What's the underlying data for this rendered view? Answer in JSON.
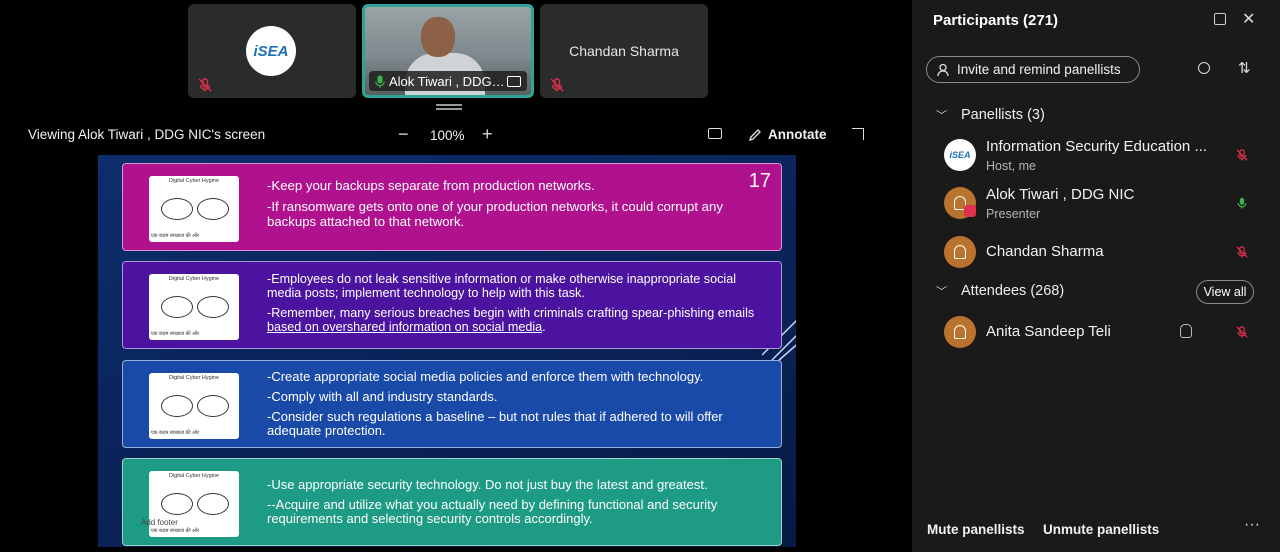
{
  "video_strip": {
    "tiles": [
      {
        "logo_text": "iSEA"
      },
      {
        "name": "Alok Tiwari , DDG NIC"
      },
      {
        "name": "Chandan Sharma"
      }
    ]
  },
  "share_bar": {
    "viewing_text": "Viewing Alok Tiwari , DDG NIC's screen",
    "zoom_level": "100%",
    "zoom_out": "−",
    "zoom_in": "+",
    "annotate_label": "Annotate"
  },
  "slide": {
    "number": "17",
    "thumb_title": "Digital Cyber Hygine",
    "thumb_word_left": "स्वच्छ",
    "thumb_word_right": "भारत",
    "thumb_sub": "एक कदम स्वच्छता की ओर",
    "cards": [
      {
        "lines": [
          "-Keep your backups separate from production networks.",
          "-If ransomware gets onto one of your production networks, it could corrupt any backups attached to that network."
        ]
      },
      {
        "lines": [
          "-Employees do not leak sensitive information or make otherwise inappropriate social media posts; implement technology to help with this task.",
          "-Remember, many serious breaches begin with criminals crafting spear-phishing emails ",
          "based on overshared information on social media",
          "."
        ]
      },
      {
        "lines": [
          "-Create appropriate social media policies and enforce them with technology.",
          "-Comply with all and industry standards.",
          "-Consider such regulations a baseline – but not rules that if adhered to will offer adequate protection."
        ]
      },
      {
        "lines": [
          "-Use appropriate security technology. Do not just buy the latest and greatest.",
          "--Acquire and utilize what you actually need by defining functional and security requirements and selecting security controls accordingly."
        ]
      }
    ],
    "ghost_text": "Add footer"
  },
  "panel": {
    "title": "Participants (271)",
    "invite_label": "Invite and remind panellists",
    "panellists_header": "Panellists (3)",
    "attendees_header": "Attendees (268)",
    "view_all_label": "View all",
    "panellists": [
      {
        "name": "Information Security Education ...",
        "role": "Host, me",
        "mic": "muted"
      },
      {
        "name": "Alok Tiwari , DDG NIC",
        "role": "Presenter",
        "mic": "active"
      },
      {
        "name": "Chandan Sharma",
        "role": "",
        "mic": "muted"
      }
    ],
    "attendees": [
      {
        "name": "Anita Sandeep Teli",
        "mic": "muted"
      }
    ],
    "mute_label": "Mute panellists",
    "unmute_label": "Unmute panellists",
    "more_label": "···"
  },
  "colors": {
    "accent_teal": "#2ea39a",
    "muted_red": "#e0304e",
    "mic_green": "#3bb54a",
    "card1": "#b0128f",
    "card2": "#4c13a0",
    "card3": "#1a4aa8",
    "card4": "#1e9b84"
  }
}
